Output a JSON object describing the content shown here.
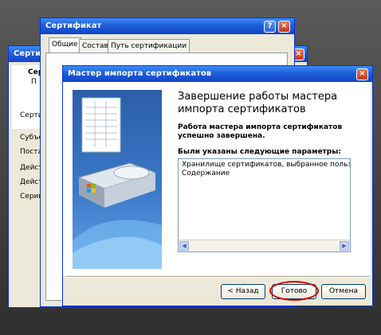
{
  "back_window": {
    "title": "Сертифик",
    "header_line1": "Серт",
    "header_line2": "П",
    "fields": [
      "Сертиф",
      "Субъект",
      "Постав",
      "Действ",
      "Действ",
      "Серийн"
    ]
  },
  "cert_window": {
    "title": "Сертификат",
    "tabs": [
      "Общие",
      "Состав",
      "Путь сертификации"
    ]
  },
  "wizard": {
    "title": "Мастер импорта сертификатов",
    "heading": "Завершение работы мастера импорта сертификатов",
    "done_text": "Работа мастера импорта сертификатов успешно завершена.",
    "params_label": "Были указаны следующие параметры:",
    "params": [
      "Хранилище сертификатов, выбранное пользователем",
      "Содержание"
    ],
    "buttons": {
      "back": "< Назад",
      "finish": "Готово",
      "cancel": "Отмена"
    }
  },
  "colors": {
    "title_bar": "#1f5fd8",
    "highlight_ring": "#d10000"
  }
}
